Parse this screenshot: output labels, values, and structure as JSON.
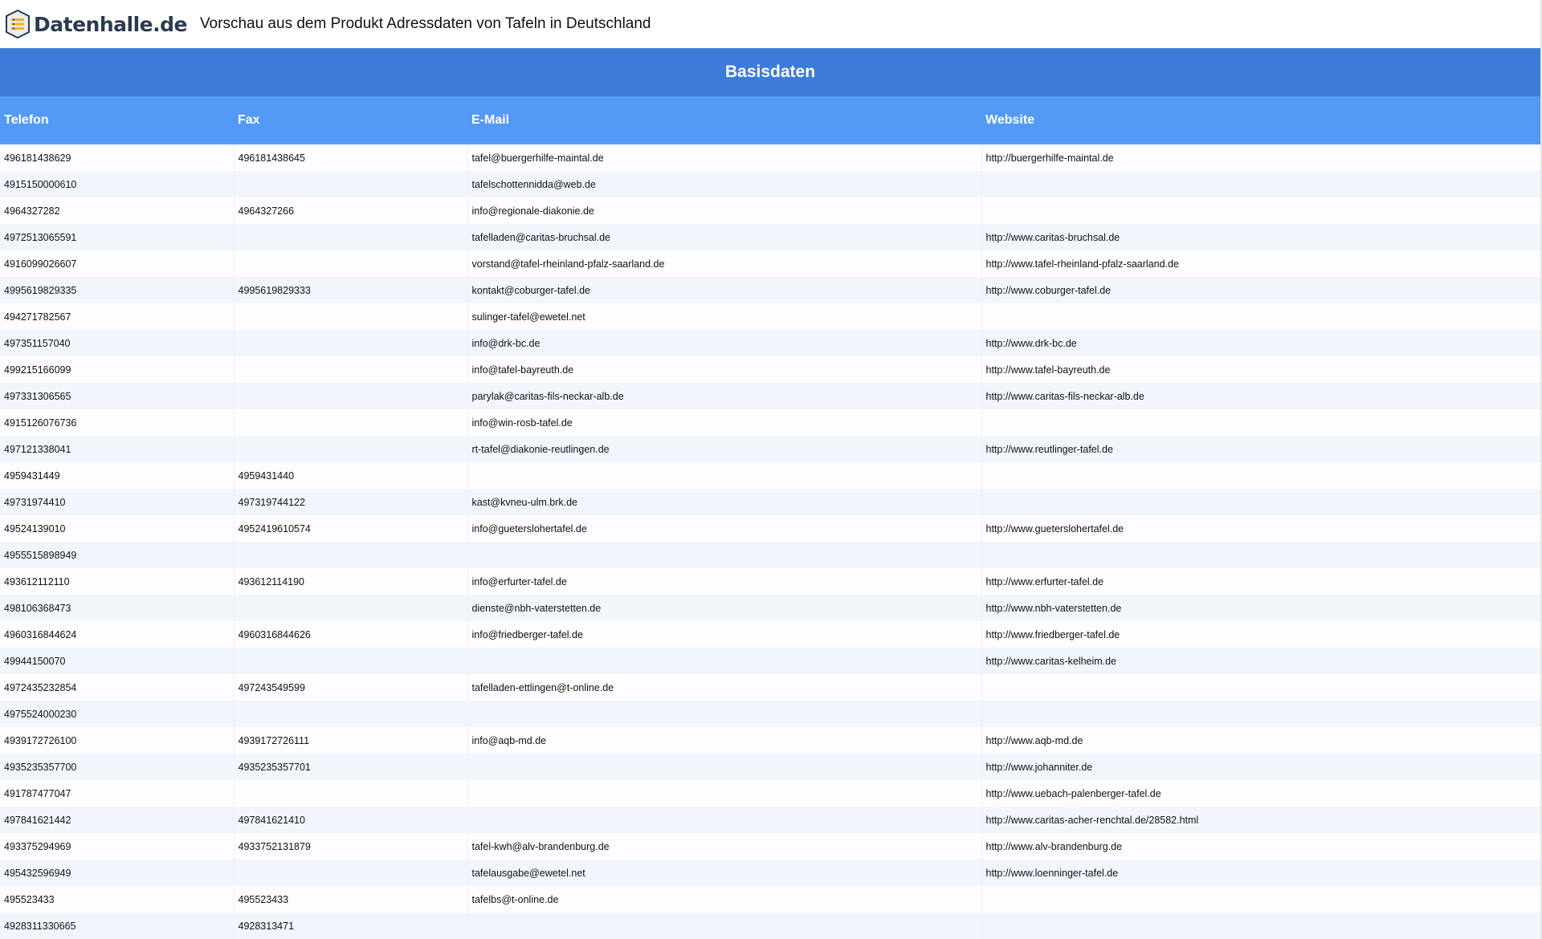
{
  "header": {
    "logo_text": "Datenhalle.de",
    "title": "Vorschau aus dem Produkt Adressdaten von Tafeln in Deutschland"
  },
  "table": {
    "section_title": "Basisdaten",
    "columns": [
      "Telefon",
      "Fax",
      "E-Mail",
      "Website"
    ],
    "rows": [
      [
        "496181438629",
        "496181438645",
        "tafel@buergerhilfe-maintal.de",
        "http://buergerhilfe-maintal.de"
      ],
      [
        "4915150000610",
        "",
        "tafelschottennidda@web.de",
        ""
      ],
      [
        "4964327282",
        "4964327266",
        "info@regionale-diakonie.de",
        ""
      ],
      [
        "4972513065591",
        "",
        "tafelladen@caritas-bruchsal.de",
        "http://www.caritas-bruchsal.de"
      ],
      [
        "4916099026607",
        "",
        "vorstand@tafel-rheinland-pfalz-saarland.de",
        "http://www.tafel-rheinland-pfalz-saarland.de"
      ],
      [
        "4995619829335",
        "4995619829333",
        "kontakt@coburger-tafel.de",
        "http://www.coburger-tafel.de"
      ],
      [
        "494271782567",
        "",
        "sulinger-tafel@ewetel.net",
        ""
      ],
      [
        "497351157040",
        "",
        "info@drk-bc.de",
        "http://www.drk-bc.de"
      ],
      [
        "499215166099",
        "",
        "info@tafel-bayreuth.de",
        "http://www.tafel-bayreuth.de"
      ],
      [
        "497331306565",
        "",
        "parylak@caritas-fils-neckar-alb.de",
        "http://www.caritas-fils-neckar-alb.de"
      ],
      [
        "4915126076736",
        "",
        "info@win-rosb-tafel.de",
        ""
      ],
      [
        "497121338041",
        "",
        "rt-tafel@diakonie-reutlingen.de",
        "http://www.reutlinger-tafel.de"
      ],
      [
        "4959431449",
        "4959431440",
        "",
        ""
      ],
      [
        "49731974410",
        "497319744122",
        "kast@kvneu-ulm.brk.de",
        ""
      ],
      [
        "49524139010",
        "4952419610574",
        "info@guetersloher­tafel.de",
        "http://www.guetersloher­tafel.de"
      ],
      [
        "4955515898949",
        "",
        "",
        ""
      ],
      [
        "493612112110",
        "493612114190",
        "info@erfurter-tafel.de",
        "http://www.erfurter-tafel.de"
      ],
      [
        "498106368473",
        "",
        "dienste@nbh-vaterstetten.de",
        "http://www.nbh-vaterstetten.de"
      ],
      [
        "4960316844624",
        "4960316844626",
        "info@friedberger-tafel.de",
        "http://www.friedberger-tafel.de"
      ],
      [
        "49944150070",
        "",
        "",
        "http://www.caritas-kelheim.de"
      ],
      [
        "4972435232854",
        "497243549599",
        "tafelladen-ettlingen@t-online.de",
        ""
      ],
      [
        "4975524000230",
        "",
        "",
        ""
      ],
      [
        "4939172726100",
        "4939172726111",
        "info@aqb-md.de",
        "http://www.aqb-md.de"
      ],
      [
        "4935235357700",
        "4935235357701",
        "",
        "http://www.johanniter.de"
      ],
      [
        "491787477047",
        "",
        "",
        "http://www.uebach-palenberger-tafel.de"
      ],
      [
        "497841621442",
        "497841621410",
        "",
        "http://www.caritas-acher-renchtal.de/28582.html"
      ],
      [
        "493375294969",
        "4933752131879",
        "tafel-kwh@alv-brandenburg.de",
        "http://www.alv-brandenburg.de"
      ],
      [
        "495432596949",
        "",
        "tafelausgabe@ewetel.net",
        "http://www.loenninger-tafel.de"
      ],
      [
        "495523433",
        "495523433",
        "tafelbs@t-online.de",
        ""
      ],
      [
        "4928311330665",
        "4928313471",
        "",
        ""
      ]
    ]
  }
}
